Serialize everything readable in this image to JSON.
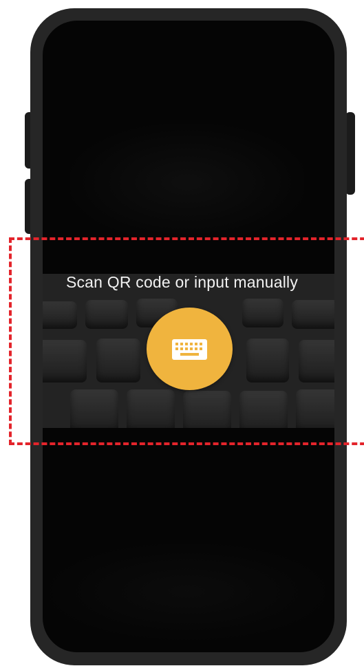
{
  "scanner": {
    "prompt": "Scan QR code or input manually",
    "manual_input_button_icon": "keyboard-icon",
    "fab_color": "#F0B43E"
  },
  "annotation": {
    "highlight_color": "#E3242B",
    "style": "dashed"
  },
  "device": {
    "frame_color": "#262626",
    "screen_color": "#050505"
  }
}
